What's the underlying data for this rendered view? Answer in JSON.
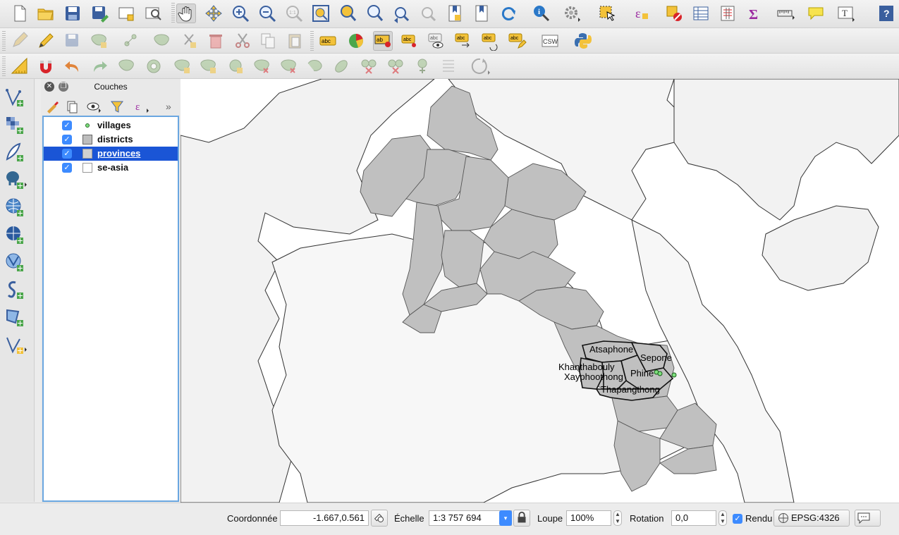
{
  "layers_panel": {
    "title": "Couches",
    "items": [
      {
        "name": "villages",
        "checked": true,
        "symbol": "point",
        "selected": false
      },
      {
        "name": "districts",
        "checked": true,
        "symbol": "polygon-gray",
        "selected": false
      },
      {
        "name": "provinces",
        "checked": true,
        "symbol": "polygon-lightgray",
        "selected": true
      },
      {
        "name": "se-asia",
        "checked": true,
        "symbol": "polygon-white",
        "selected": false
      }
    ]
  },
  "map": {
    "district_labels": [
      "Atsaphone",
      "Sepone",
      "Khanthabouly",
      "Phine",
      "Xayphoothong",
      "Thapangthong"
    ],
    "colors": {
      "province_fill": "#c0c0c0",
      "background": "#ffffff",
      "land": "#f2f2f2",
      "outline": "#3a3a3a",
      "village_point": "#7de07d"
    }
  },
  "toolbar_csw_label": "CSW",
  "statusbar": {
    "coord_label": "Coordonnée",
    "coord_value": "-1.667,0.561",
    "scale_label": "Échelle",
    "scale_value": "1:3 757 694",
    "magnifier_label": "Loupe",
    "magnifier_value": "100%",
    "rotation_label": "Rotation",
    "rotation_value": "0,0",
    "render_label": "Rendu",
    "render_checked": true,
    "crs_label": "EPSG:4326"
  }
}
